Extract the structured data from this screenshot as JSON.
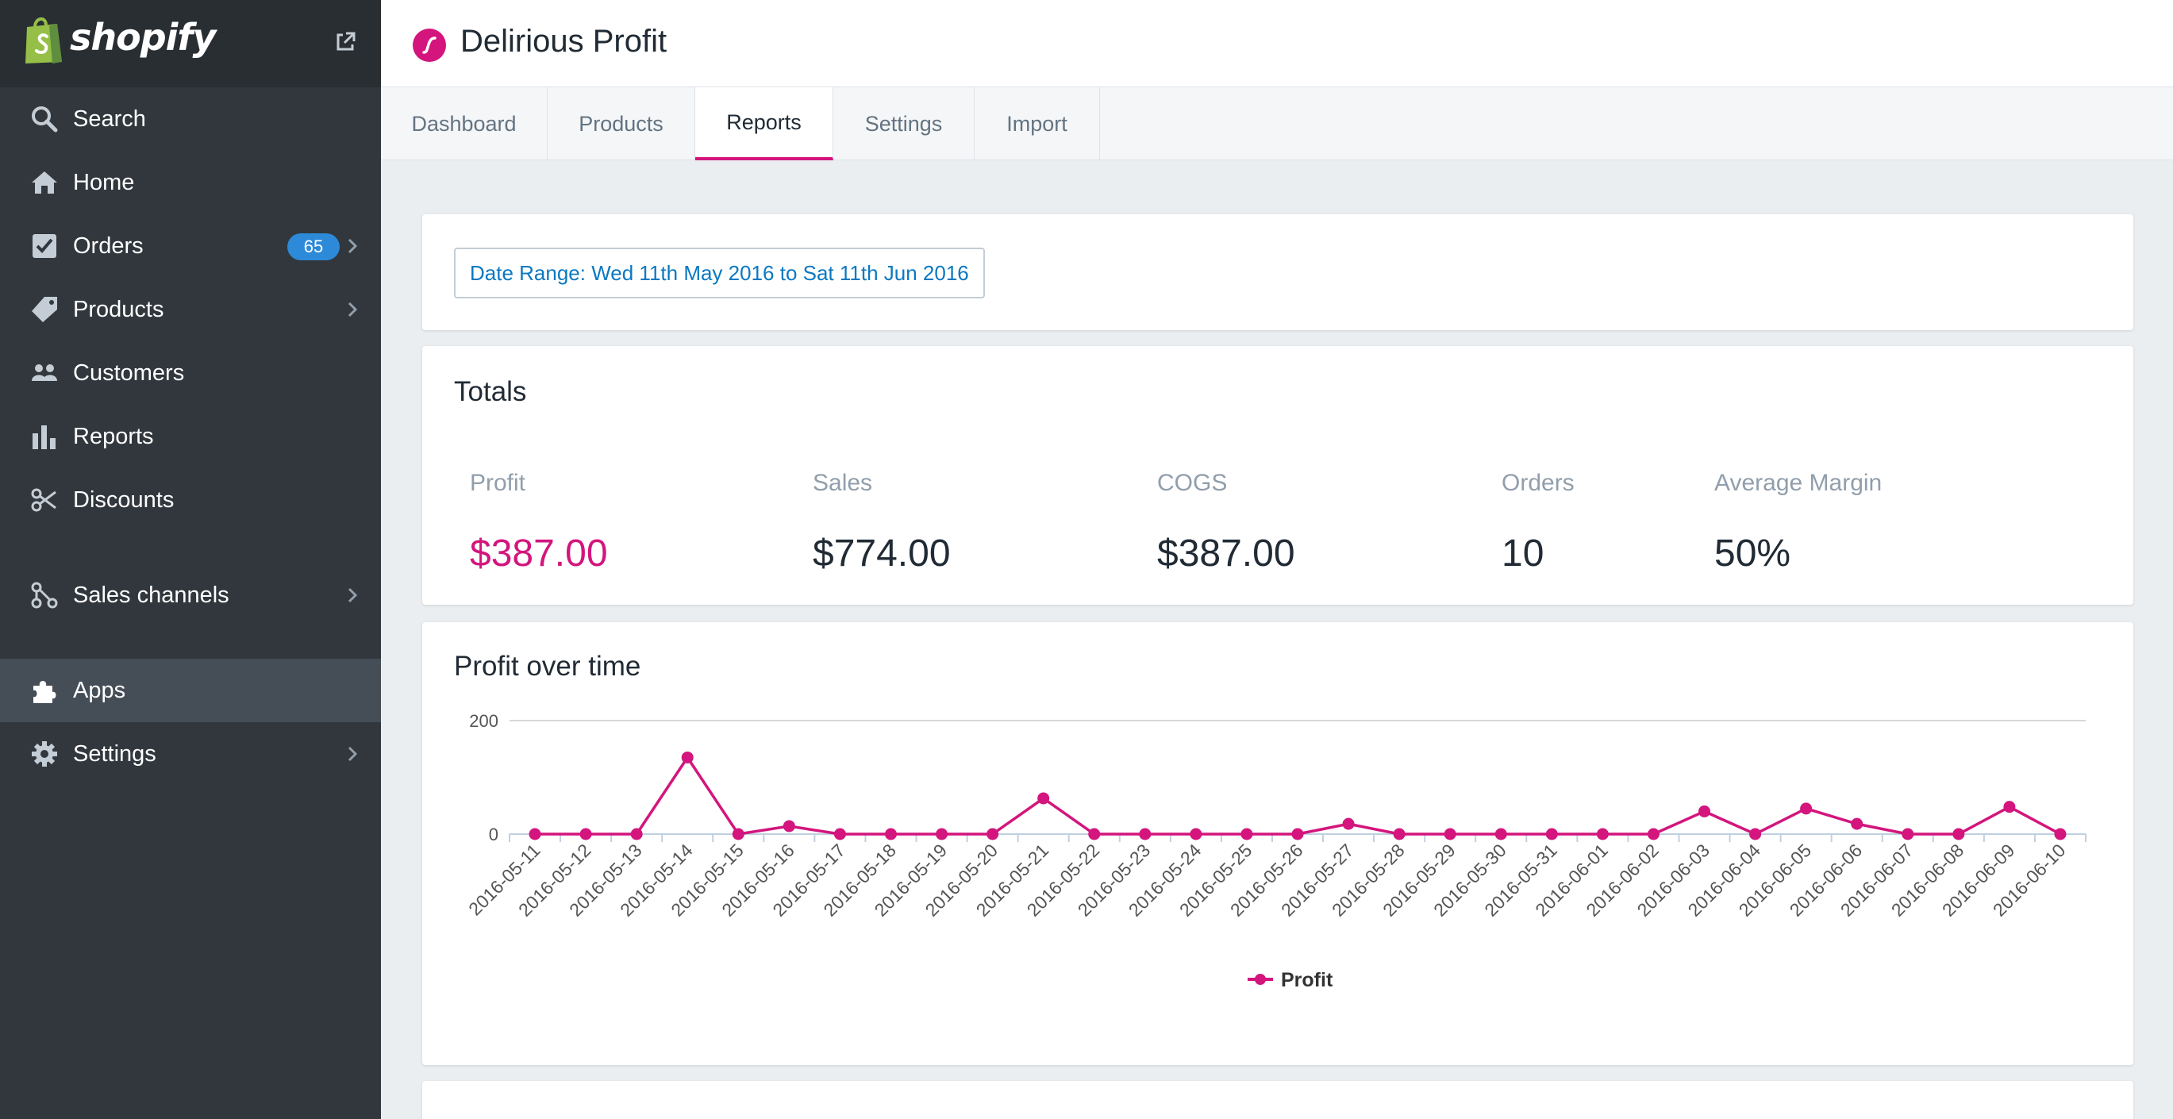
{
  "sidebar": {
    "logo_text": "shopify",
    "items": [
      {
        "label": "Search",
        "icon": "search-icon"
      },
      {
        "label": "Home",
        "icon": "home-icon"
      },
      {
        "label": "Orders",
        "icon": "orders-icon",
        "badge": "65"
      },
      {
        "label": "Products",
        "icon": "tag-icon"
      },
      {
        "label": "Customers",
        "icon": "customers-icon"
      },
      {
        "label": "Reports",
        "icon": "reports-icon"
      },
      {
        "label": "Discounts",
        "icon": "discounts-icon"
      },
      {
        "label": "Sales channels",
        "icon": "sales-channels-icon"
      },
      {
        "label": "Apps",
        "icon": "puzzle-icon",
        "active": true
      },
      {
        "label": "Settings",
        "icon": "gear-icon"
      }
    ]
  },
  "header": {
    "title": "Delirious Profit"
  },
  "tabs": [
    {
      "label": "Dashboard"
    },
    {
      "label": "Products"
    },
    {
      "label": "Reports",
      "active": true
    },
    {
      "label": "Settings"
    },
    {
      "label": "Import"
    }
  ],
  "date_range": {
    "label": "Date Range: Wed 11th May 2016 to Sat 11th Jun 2016"
  },
  "totals": {
    "title": "Totals",
    "stats": [
      {
        "label": "Profit",
        "value": "$387.00"
      },
      {
        "label": "Sales",
        "value": "$774.00"
      },
      {
        "label": "COGS",
        "value": "$387.00"
      },
      {
        "label": "Orders",
        "value": "10"
      },
      {
        "label": "Average Margin",
        "value": "50%"
      }
    ]
  },
  "profit_chart": {
    "title": "Profit over time"
  },
  "colors": {
    "accent": "#d3157d",
    "sidebar": "#31373d",
    "link": "#0b78c1"
  },
  "chart_data": {
    "type": "line",
    "title": "Profit over time",
    "xlabel": "",
    "ylabel": "",
    "ylim": [
      0,
      200
    ],
    "yticks": [
      0,
      200
    ],
    "grid": true,
    "legend": "bottom",
    "x": [
      "2016-05-11",
      "2016-05-12",
      "2016-05-13",
      "2016-05-14",
      "2016-05-15",
      "2016-05-16",
      "2016-05-17",
      "2016-05-18",
      "2016-05-19",
      "2016-05-20",
      "2016-05-21",
      "2016-05-22",
      "2016-05-23",
      "2016-05-24",
      "2016-05-25",
      "2016-05-26",
      "2016-05-27",
      "2016-05-28",
      "2016-05-29",
      "2016-05-30",
      "2016-05-31",
      "2016-06-01",
      "2016-06-02",
      "2016-06-03",
      "2016-06-04",
      "2016-06-05",
      "2016-06-06",
      "2016-06-07",
      "2016-06-08",
      "2016-06-09",
      "2016-06-10"
    ],
    "series": [
      {
        "name": "Profit",
        "color": "#d3157d",
        "values": [
          0,
          0,
          0,
          135,
          0,
          14,
          0,
          0,
          0,
          0,
          63,
          0,
          0,
          0,
          0,
          0,
          18,
          0,
          0,
          0,
          0,
          0,
          0,
          40,
          0,
          45,
          18,
          0,
          0,
          48,
          0
        ]
      }
    ]
  }
}
